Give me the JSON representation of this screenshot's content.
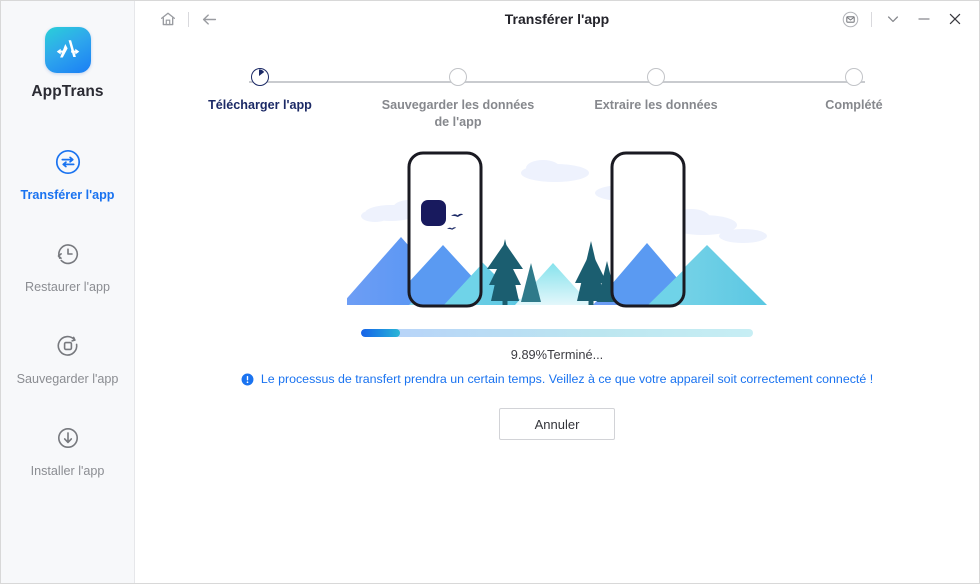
{
  "window": {
    "title": "Transférer l'app",
    "home_icon": "home-icon",
    "back_icon": "back-arrow-icon",
    "feedback_icon": "envelope-icon",
    "chevron_icon": "chevron-down-icon",
    "minimize_icon": "minimize-icon",
    "close_icon": "close-icon"
  },
  "sidebar": {
    "brand": "AppTrans",
    "brand_logo_icon": "apptrans-logo-icon",
    "accent": "#1a73f0",
    "items": [
      {
        "label": "Transférer l'app",
        "icon": "transfer-icon",
        "active": true
      },
      {
        "label": "Restaurer l'app",
        "icon": "restore-clock-icon",
        "active": false
      },
      {
        "label": "Sauvegarder l'app",
        "icon": "backup-icon",
        "active": false
      },
      {
        "label": "Installer l'app",
        "icon": "install-download-icon",
        "active": false
      }
    ]
  },
  "stepper": {
    "steps": [
      {
        "label": "Télécharger l'app",
        "active": true
      },
      {
        "label": "Sauvegarder les données de l'app",
        "active": false
      },
      {
        "label": "Extraire les données",
        "active": false
      },
      {
        "label": "Complété",
        "active": false
      }
    ]
  },
  "progress": {
    "percent": 9.89,
    "percent_text": "9.89%Terminé...",
    "fill_start_color": "#1763e8",
    "fill_end_color": "#2ab6d6",
    "track_color": "#b7d1fa"
  },
  "notice": {
    "icon": "info-exclamation-icon",
    "text": "Le processus de transfert prendra un certain temps. Veillez à ce que votre appareil soit correctement connecté !",
    "color": "#1a73f0"
  },
  "actions": {
    "cancel_label": "Annuler"
  },
  "illustration": {
    "name": "two-phones-landscape-illustration",
    "colors": {
      "phone_frame": "#1a1a22",
      "mountain_blue": "#5a9af2",
      "mountain_cyan": "#6fd3e8",
      "tree_dark": "#1b5e70",
      "cloud": "#eef3fd",
      "app_tile": "#181a5e"
    }
  }
}
